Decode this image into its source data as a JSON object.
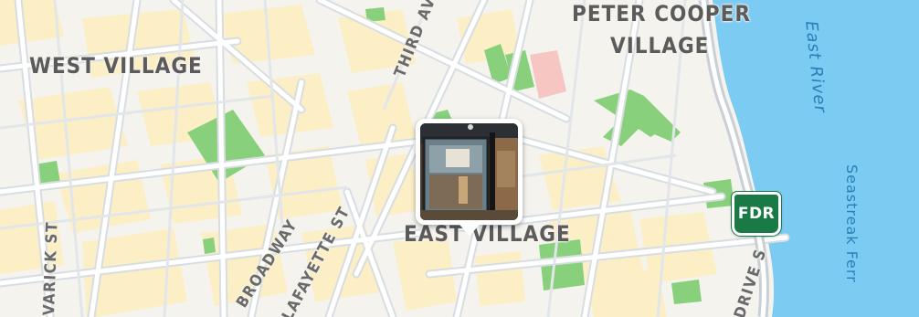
{
  "map": {
    "labels": {
      "west_village": "WEST VILLAGE",
      "peter_cooper": "PETER COOPER",
      "village": "VILLAGE",
      "east_village": "EAST VILLAGE",
      "third_ave": "THIRD AVE",
      "broadway": "BROADWAY",
      "lafayette_st": "LAFAYETTE ST",
      "varick_st": "VARICK ST",
      "drive_s": "DRIVE S",
      "east_river": "East River",
      "seastreak_ferry": "Seastreak Ferr"
    },
    "highway_shield": "FDR",
    "colors": {
      "water": "#7ccbf3",
      "park": "#86cf7a",
      "block": "#fdf0c8",
      "land": "#f4f3ee",
      "road": "#d9dee3",
      "highway_shield": "#1a7a45"
    },
    "photo_pin": {
      "icon": "photo-thumbnail-icon"
    }
  }
}
